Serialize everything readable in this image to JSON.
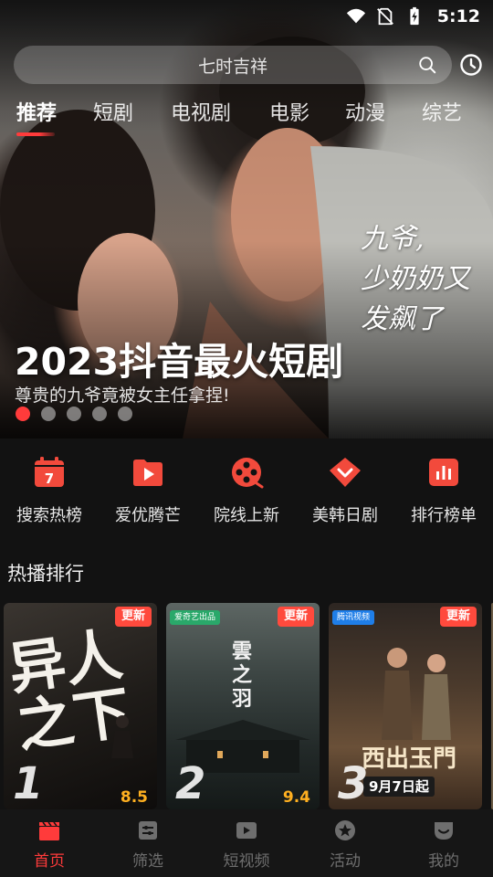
{
  "status_bar": {
    "time": "5:12",
    "icons": [
      "wifi-icon",
      "no-sim-icon",
      "battery-charging-icon"
    ]
  },
  "search": {
    "placeholder": "七时吉祥",
    "icon": "search-icon",
    "history_icon": "history-icon"
  },
  "tabs": [
    {
      "label": "推荐",
      "active": true
    },
    {
      "label": "短剧",
      "active": false
    },
    {
      "label": "电视剧",
      "active": false
    },
    {
      "label": "电影",
      "active": false
    },
    {
      "label": "动漫",
      "active": false
    },
    {
      "label": "综艺",
      "active": false
    }
  ],
  "hero": {
    "title": "2023抖音最火短剧",
    "subtitle": "尊贵的九爷竟被女主任拿捏!",
    "poster_text": [
      "九爷,",
      "少奶奶又",
      "发飙了"
    ],
    "slide_count": 5,
    "active_slide": 1
  },
  "shortcuts": [
    {
      "label": "搜索热榜",
      "icon": "calendar-icon",
      "icon_text": "7"
    },
    {
      "label": "爱优腾芒",
      "icon": "play-folder-icon"
    },
    {
      "label": "院线上新",
      "icon": "film-reel-icon"
    },
    {
      "label": "美韩日剧",
      "icon": "heart-gem-icon"
    },
    {
      "label": "排行榜单",
      "icon": "bar-chart-icon"
    }
  ],
  "section_title": "热播排行",
  "cards": [
    {
      "rank": "1",
      "score": "8.5",
      "badge": "更新",
      "art_title": "异人之下"
    },
    {
      "rank": "2",
      "score": "9.4",
      "badge": "更新",
      "platform": "爱奇艺出品",
      "art_title": "雲之羽"
    },
    {
      "rank": "3",
      "badge": "更新",
      "platform": "腾讯视频",
      "art_title": "西出玉門",
      "date_label": "9月7日起"
    }
  ],
  "bottom_nav": [
    {
      "label": "首页",
      "icon": "clapperboard-icon",
      "active": true
    },
    {
      "label": "筛选",
      "icon": "filter-icon",
      "active": false
    },
    {
      "label": "短视频",
      "icon": "video-icon",
      "active": false
    },
    {
      "label": "活动",
      "icon": "star-badge-icon",
      "active": false
    },
    {
      "label": "我的",
      "icon": "profile-icon",
      "active": false
    }
  ],
  "colors": {
    "accent": "#ff3b3b",
    "score": "#ffb020",
    "background": "#121212"
  }
}
